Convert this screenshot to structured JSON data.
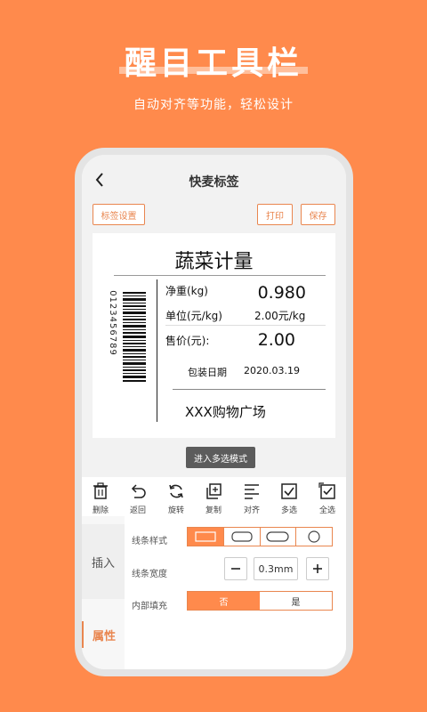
{
  "hero": {
    "title": "醒目工具栏",
    "subtitle": "自动对齐等功能，轻松设计"
  },
  "app": {
    "nav_title": "快麦标签",
    "buttons": {
      "label_settings": "标签设置",
      "print": "打印",
      "save": "保存"
    }
  },
  "label": {
    "title": "蔬菜计量",
    "barcode_digits": "0123456789",
    "weight_label": "净重(kg)",
    "weight_value": "0.980",
    "unit_label": "单位(元/kg)",
    "unit_value": "2.00元/kg",
    "price_label": "售价(元):",
    "price_value": "2.00",
    "pack_label": "包装日期",
    "pack_value": "2020.03.19",
    "store": "XXX购物广场"
  },
  "insert_button": "进入多选模式",
  "toolbar": [
    {
      "icon": "trash-icon",
      "label": "删除"
    },
    {
      "icon": "undo-icon",
      "label": "返回"
    },
    {
      "icon": "rotate-icon",
      "label": "旋转"
    },
    {
      "icon": "copy-icon",
      "label": "复制"
    },
    {
      "icon": "align-icon",
      "label": "对齐"
    },
    {
      "icon": "multiselect-icon",
      "label": "多选"
    },
    {
      "icon": "select-all-icon",
      "label": "全选"
    }
  ],
  "panel": {
    "tab_insert": "插入",
    "tab_attributes": "属性",
    "line_style_label": "线条样式",
    "line_width_label": "线条宽度",
    "line_width_value": "0.3mm",
    "inner_fill_label": "内部填充",
    "fill_no": "否",
    "fill_yes": "是",
    "line_styles": [
      "rectangle",
      "rounded-rectangle",
      "capsule",
      "circle"
    ],
    "line_style_selected": "rectangle",
    "fill_selected": "否"
  },
  "colors": {
    "background": "#FF8A4C",
    "accent": "#E9864F"
  }
}
